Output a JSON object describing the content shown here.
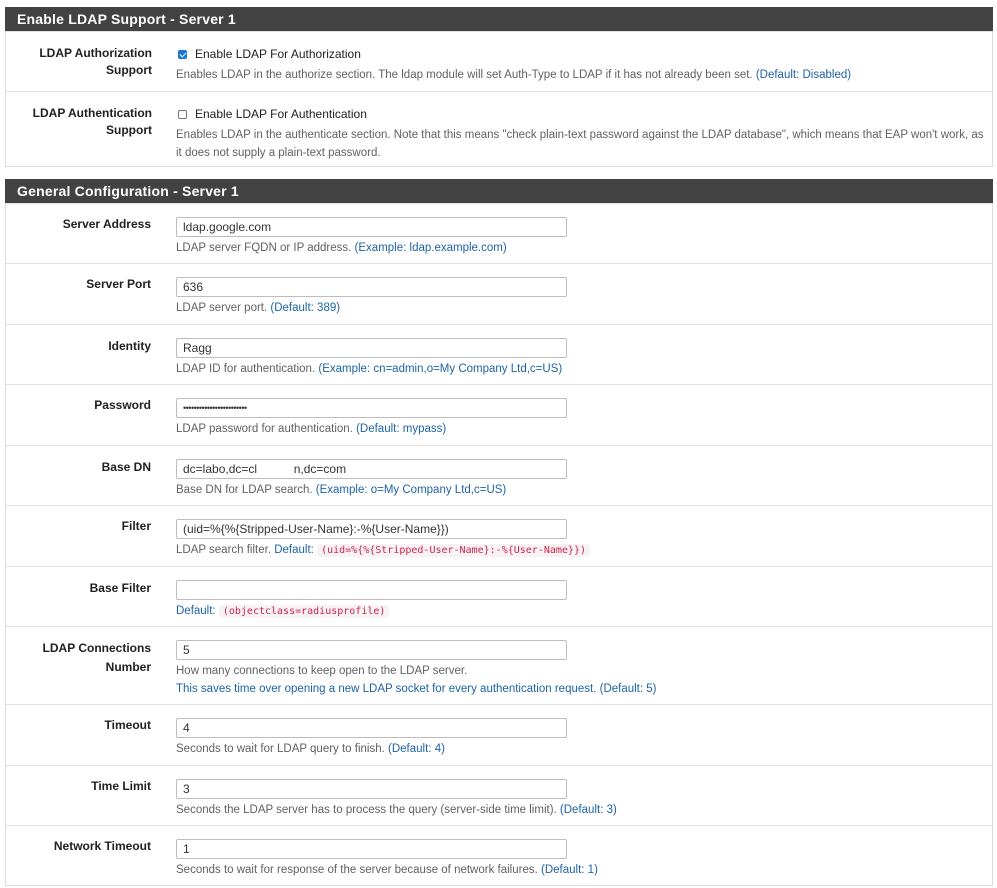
{
  "section1": {
    "title": "Enable LDAP Support - Server 1",
    "authorization": {
      "label": "LDAP Authorization Support",
      "checkbox_label": "Enable LDAP For Authorization",
      "checked": true,
      "help": "Enables LDAP in the authorize section. The ldap module will set Auth-Type to LDAP if it has not already been set.",
      "default": "(Default: Disabled)"
    },
    "authentication": {
      "label": "LDAP Authentication Support",
      "checkbox_label": "Enable LDAP For Authentication",
      "checked": false,
      "help": "Enables LDAP in the authenticate section. Note that this means \"check plain-text password against the LDAP database\", which means that EAP won't work, as it does not supply a plain-text password."
    }
  },
  "section2": {
    "title": "General Configuration - Server 1",
    "server_address": {
      "label": "Server Address",
      "value": "ldap.google.com",
      "help": "LDAP server FQDN or IP address.",
      "default": "(Example: ldap.example.com)"
    },
    "server_port": {
      "label": "Server Port",
      "value": "636",
      "help": "LDAP server port.",
      "default": "(Default: 389)"
    },
    "identity": {
      "label": "Identity",
      "value": "Ragg",
      "help": "LDAP ID for authentication.",
      "default": "(Example: cn=admin,o=My Company Ltd,c=US)"
    },
    "password": {
      "label": "Password",
      "value": "••••••••••••••••••••••••",
      "help": "LDAP password for authentication.",
      "default": "(Default: mypass)"
    },
    "base_dn": {
      "label": "Base DN",
      "value": "dc=labo,dc=cl           n,dc=com",
      "help": "Base DN for LDAP search.",
      "default": "(Example: o=My Company Ltd,c=US)"
    },
    "filter": {
      "label": "Filter",
      "value": "(uid=%{%{Stripped-User-Name}:-%{User-Name}})",
      "help": "LDAP search filter.",
      "default_prefix": "Default:",
      "default_code": "(uid=%{%{Stripped-User-Name}:-%{User-Name}})"
    },
    "base_filter": {
      "label": "Base Filter",
      "value": "",
      "default_prefix": "Default:",
      "default_code": "(objectclass=radiusprofile)"
    },
    "connections": {
      "label": "LDAP Connections Number",
      "value": "5",
      "help": "How many connections to keep open to the LDAP server.",
      "help2": "This saves time over opening a new LDAP socket for every authentication request.",
      "default": "(Default: 5)"
    },
    "timeout": {
      "label": "Timeout",
      "value": "4",
      "help": "Seconds to wait for LDAP query to finish.",
      "default": "(Default: 4)"
    },
    "time_limit": {
      "label": "Time Limit",
      "value": "3",
      "help": "Seconds the LDAP server has to process the query (server-side time limit).",
      "default": "(Default: 3)"
    },
    "network_timeout": {
      "label": "Network Timeout",
      "value": "1",
      "help": "Seconds to wait for response of the server because of network failures.",
      "default": "(Default: 1)"
    }
  },
  "colors": {
    "header_bg": "#424242",
    "accent": "#1976d2",
    "link": "#1e63a5",
    "code": "#c7254e"
  }
}
